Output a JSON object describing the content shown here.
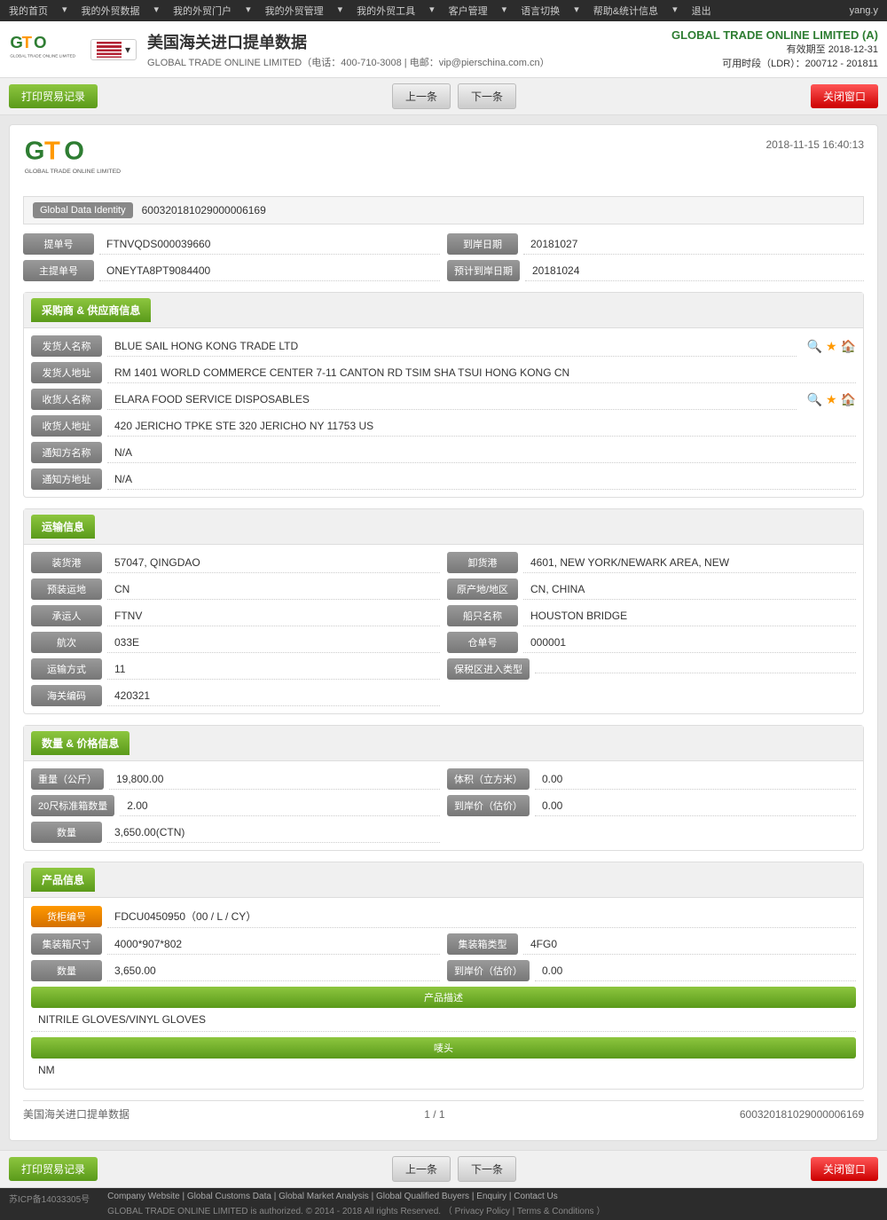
{
  "nav": {
    "items": [
      "我的首页",
      "我的外贸数据",
      "我的外贸门户",
      "我的外贸管理",
      "我的外贸工具",
      "客户管理",
      "语言切换",
      "帮助&统计信息",
      "退出"
    ],
    "user": "yang.y"
  },
  "header": {
    "title": "美国海关进口提单数据",
    "company_name": "GLOBAL TRADE ONLINE LIMITED (A)",
    "validity": "有效期至 2018-12-31",
    "ldr": "可用时段（LDR）：200712 - 201811",
    "contact_phone": "400-710-3008",
    "contact_email": "vip@pierschina.com.cn",
    "company_full": "GLOBAL TRADE ONLINE LIMITED（电话：400-710-3008 | 电邮：vip@pierschina.com.cn）"
  },
  "toolbar": {
    "print_label": "打印贸易记录",
    "prev_label": "上一条",
    "next_label": "下一条",
    "close_label": "关闭窗口"
  },
  "record": {
    "datetime": "2018-11-15 16:40:13",
    "gdi_label": "Global Data Identity",
    "gdi_value": "600320181029000006169",
    "fields": {
      "bill_no_label": "提单号",
      "bill_no_value": "FTNVQDS000039660",
      "arrive_date_label": "到岸日期",
      "arrive_date_value": "20181027",
      "master_bill_label": "主提单号",
      "master_bill_value": "ONEYTA8PT9084400",
      "planned_arrive_label": "预计到岸日期",
      "planned_arrive_value": "20181024"
    },
    "buyer_supplier": {
      "section_label": "采购商 & 供应商信息",
      "shipper_name_label": "发货人名称",
      "shipper_name_value": "BLUE SAIL HONG KONG TRADE LTD",
      "shipper_addr_label": "发货人地址",
      "shipper_addr_value": "RM 1401 WORLD COMMERCE CENTER 7-11 CANTON RD TSIM SHA TSUI HONG KONG CN",
      "consignee_name_label": "收货人名称",
      "consignee_name_value": "ELARA FOOD SERVICE DISPOSABLES",
      "consignee_addr_label": "收货人地址",
      "consignee_addr_value": "420 JERICHO TPKE STE 320 JERICHO NY 11753 US",
      "notify_name_label": "通知方名称",
      "notify_name_value": "N/A",
      "notify_addr_label": "通知方地址",
      "notify_addr_value": "N/A"
    },
    "transport": {
      "section_label": "运输信息",
      "loading_port_label": "装货港",
      "loading_port_value": "57047, QINGDAO",
      "discharge_port_label": "卸货港",
      "discharge_port_value": "4601, NEW YORK/NEWARK AREA, NEW",
      "pre_transport_label": "预装运地",
      "pre_transport_value": "CN",
      "origin_region_label": "原产地/地区",
      "origin_region_value": "CN, CHINA",
      "carrier_label": "承运人",
      "carrier_value": "FTNV",
      "vessel_name_label": "船只名称",
      "vessel_name_value": "HOUSTON BRIDGE",
      "voyage_label": "航次",
      "voyage_value": "033E",
      "warehouse_no_label": "仓单号",
      "warehouse_no_value": "000001",
      "transport_mode_label": "运输方式",
      "transport_mode_value": "11",
      "bonded_type_label": "保税区进入类型",
      "bonded_type_value": "",
      "customs_code_label": "海关编码",
      "customs_code_value": "420321"
    },
    "quantity_price": {
      "section_label": "数量 & 价格信息",
      "weight_label": "重量（公斤）",
      "weight_value": "19,800.00",
      "volume_label": "体积（立方米）",
      "volume_value": "0.00",
      "containers_20_label": "20尺标准箱数量",
      "containers_20_value": "2.00",
      "arrive_price_label": "到岸价（估价）",
      "arrive_price_value": "0.00",
      "quantity_label": "数量",
      "quantity_value": "3,650.00(CTN)"
    },
    "product": {
      "section_label": "产品信息",
      "container_no_label": "货柜编号",
      "container_no_value": "FDCU0450950（00 / L / CY）",
      "container_size_label": "集装箱尺寸",
      "container_size_value": "4000*907*802",
      "container_type_label": "集装箱类型",
      "container_type_value": "4FG0",
      "quantity_label": "数量",
      "quantity_value": "3,650.00",
      "arrive_price_label": "到岸价（估价）",
      "arrive_price_value": "0.00",
      "description_label": "产品描述",
      "description_value": "NITRILE GLOVES/VINYL GLOVES",
      "marks_label": "唛头",
      "marks_value": "NM"
    },
    "footer": {
      "source": "美国海关进口提单数据",
      "page": "1 / 1",
      "record_id": "600320181029000006169"
    }
  },
  "footer": {
    "icp": "苏ICP备14033305号",
    "links": [
      "Company Website",
      "Global Customs Data",
      "Global Market Analysis",
      "Global Qualified Buyers",
      "Enquiry",
      "Contact Us"
    ],
    "copyright": "GLOBAL TRADE ONLINE LIMITED is authorized. © 2014 - 2018 All rights Reserved.",
    "privacy": "Privacy Policy",
    "terms": "Terms & Conditions"
  }
}
